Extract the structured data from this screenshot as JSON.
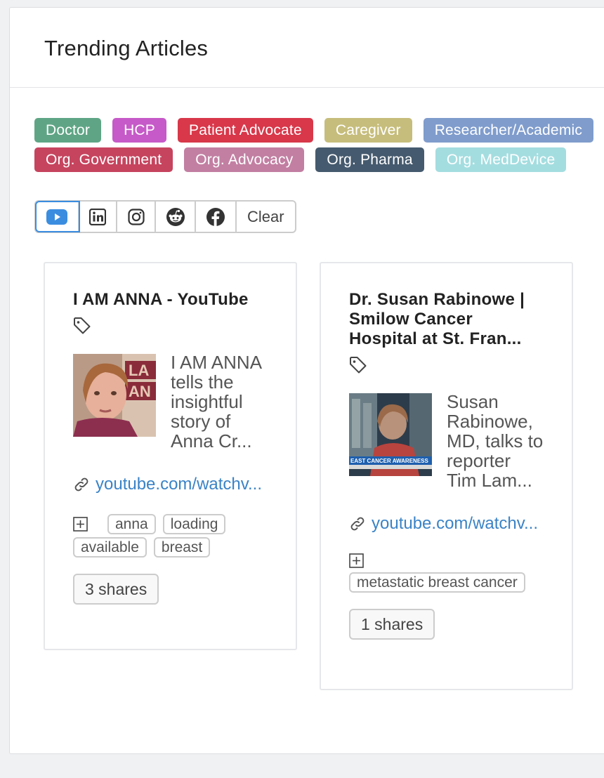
{
  "panel": {
    "title": "Trending Articles"
  },
  "tags": {
    "row1": [
      {
        "label": "Doctor",
        "color": "#5fa585"
      },
      {
        "label": "HCP",
        "color": "#c65ac8"
      },
      {
        "label": "Patient Advocate",
        "color": "#d8384a"
      },
      {
        "label": "Caregiver",
        "color": "#c6bd7c"
      },
      {
        "label": "Researcher/Academic",
        "color": "#7f9ccc"
      }
    ],
    "row2": [
      {
        "label": "Org. Government",
        "color": "#c6445e"
      },
      {
        "label": "Org. Advocacy",
        "color": "#c27fa2"
      },
      {
        "label": "Org. Pharma",
        "color": "#455a6e"
      },
      {
        "label": "Org. MedDevice",
        "color": "#a4dde0"
      }
    ]
  },
  "filters": {
    "buttons": [
      {
        "icon": "youtube-icon",
        "active": true
      },
      {
        "icon": "linkedin-icon",
        "active": false
      },
      {
        "icon": "instagram-icon",
        "active": false
      },
      {
        "icon": "reddit-icon",
        "active": false
      },
      {
        "icon": "facebook-icon",
        "active": false
      }
    ],
    "clear_label": "Clear"
  },
  "cards": [
    {
      "title": "I AM ANNA - YouTube",
      "description": "I AM ANNA tells the insightful story of Anna Cr...",
      "link": "youtube.com/watchv...",
      "keywords": [
        "anna",
        "loading",
        "available",
        "breast"
      ],
      "shares": "3 shares",
      "thumb_text": "I AM ANNA"
    },
    {
      "title": "Dr. Susan Rabinowe | Smilow Cancer Hospital at St. Fran...",
      "description": "Susan Rabinowe, MD, talks to reporter Tim Lam...",
      "link": "youtube.com/watchv...",
      "keywords": [
        "metastatic breast cancer"
      ],
      "shares": "1 shares",
      "thumb_text": "EAST CANCER AWARENESS"
    }
  ]
}
